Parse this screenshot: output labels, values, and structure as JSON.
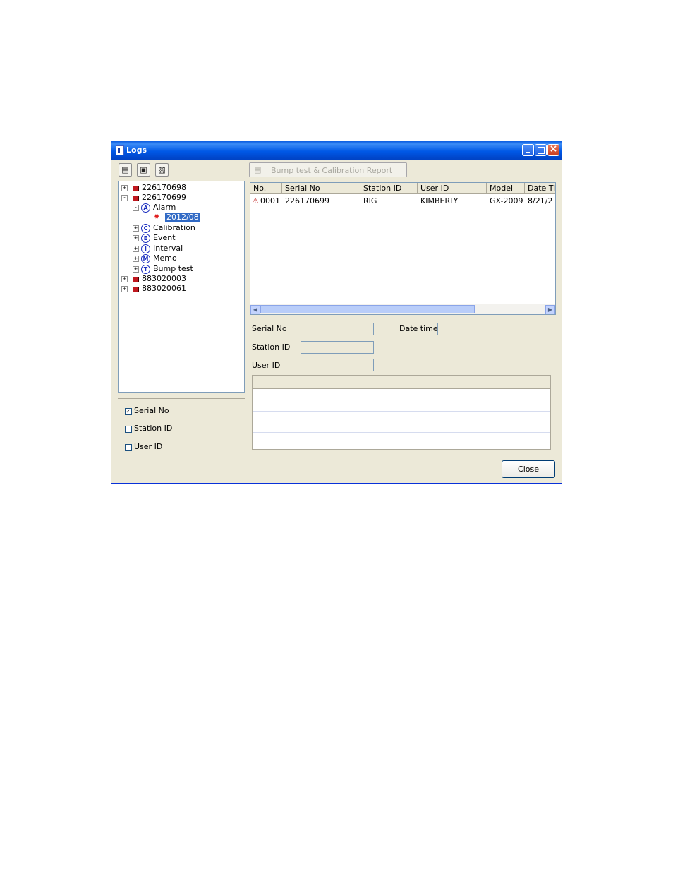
{
  "window": {
    "title": "Logs"
  },
  "toolbar": {
    "print_icon": "printer-icon",
    "save_icon": "floppy-disk-icon",
    "clipboard_icon": "clipboard-icon",
    "report_label": "Bump test & Calibration Report"
  },
  "tree": {
    "devices": [
      "226170698",
      "226170699",
      "883020003",
      "883020061"
    ],
    "categories": [
      {
        "letter": "A",
        "label": "Alarm"
      },
      {
        "letter": "C",
        "label": "Calibration"
      },
      {
        "letter": "E",
        "label": "Event"
      },
      {
        "letter": "I",
        "label": "Interval"
      },
      {
        "letter": "M",
        "label": "Memo"
      },
      {
        "letter": "T",
        "label": "Bump test"
      }
    ],
    "selected_period": "2012/08"
  },
  "filters": [
    {
      "label": "Serial No",
      "checked": true
    },
    {
      "label": "Station ID",
      "checked": false
    },
    {
      "label": "User ID",
      "checked": false
    }
  ],
  "list": {
    "columns": [
      "No.",
      "Serial No",
      "Station ID",
      "User ID",
      "Model",
      "Date Ti"
    ],
    "rows": [
      {
        "no": "0001",
        "serial": "226170699",
        "station": "RIG",
        "user": "KIMBERLY",
        "model": "GX-2009",
        "date": "8/21/2"
      }
    ]
  },
  "detail": {
    "serial_label": "Serial No",
    "station_label": "Station ID",
    "user_label": "User ID",
    "date_label": "Date time"
  },
  "footer": {
    "close_label": "Close"
  }
}
